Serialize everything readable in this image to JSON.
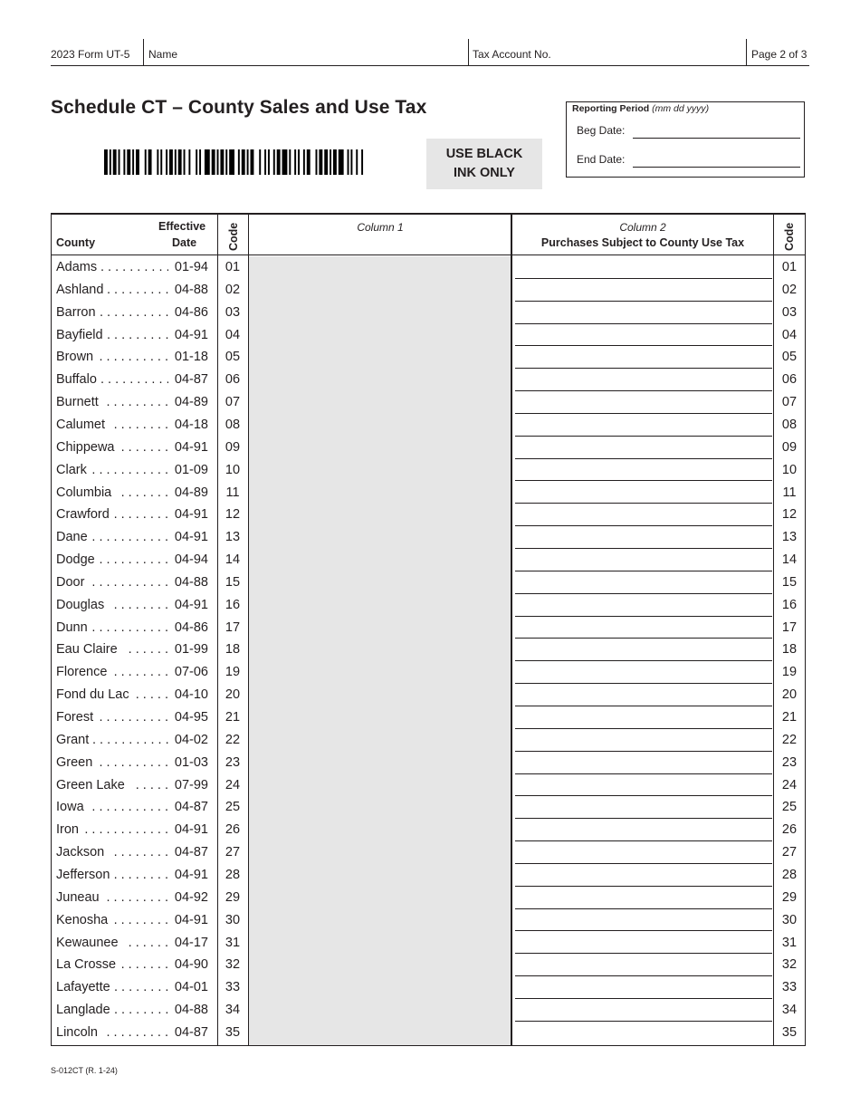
{
  "header": {
    "form": "2023 Form UT-5",
    "name_label": "Name",
    "tax_account_label": "Tax Account No.",
    "page": "Page 2 of 3"
  },
  "title": "Schedule CT – County Sales and Use Tax",
  "ink_notice": {
    "line1": "USE BLACK",
    "line2": "INK ONLY"
  },
  "reporting_period": {
    "title": "Reporting Period",
    "format_hint": "(mm dd yyyy)",
    "beg_label": "Beg Date:",
    "beg_value": "",
    "end_label": "End Date:",
    "end_value": ""
  },
  "table": {
    "headers": {
      "county": "County",
      "effective": "Effective",
      "date": "Date",
      "code": "Code",
      "column1": "Column 1",
      "column2": "Column 2",
      "column2_title": "Purchases Subject to County Use Tax",
      "code_right": "Code"
    },
    "rows": [
      {
        "county": "Adams",
        "date": "01-94",
        "code": "01"
      },
      {
        "county": "Ashland",
        "date": "04-88",
        "code": "02"
      },
      {
        "county": "Barron",
        "date": "04-86",
        "code": "03"
      },
      {
        "county": "Bayfield",
        "date": "04-91",
        "code": "04"
      },
      {
        "county": "Brown",
        "date": "01-18",
        "code": "05"
      },
      {
        "county": "Buffalo",
        "date": "04-87",
        "code": "06"
      },
      {
        "county": "Burnett",
        "date": "04-89",
        "code": "07"
      },
      {
        "county": "Calumet",
        "date": "04-18",
        "code": "08"
      },
      {
        "county": "Chippewa",
        "date": "04-91",
        "code": "09"
      },
      {
        "county": "Clark",
        "date": "01-09",
        "code": "10"
      },
      {
        "county": "Columbia",
        "date": "04-89",
        "code": "11"
      },
      {
        "county": "Crawford",
        "date": "04-91",
        "code": "12"
      },
      {
        "county": "Dane",
        "date": "04-91",
        "code": "13"
      },
      {
        "county": "Dodge",
        "date": "04-94",
        "code": "14"
      },
      {
        "county": "Door",
        "date": "04-88",
        "code": "15"
      },
      {
        "county": "Douglas",
        "date": "04-91",
        "code": "16"
      },
      {
        "county": "Dunn",
        "date": "04-86",
        "code": "17"
      },
      {
        "county": "Eau Claire",
        "date": "01-99",
        "code": "18"
      },
      {
        "county": "Florence",
        "date": "07-06",
        "code": "19"
      },
      {
        "county": "Fond du Lac",
        "date": "04-10",
        "code": "20"
      },
      {
        "county": "Forest",
        "date": "04-95",
        "code": "21"
      },
      {
        "county": "Grant",
        "date": "04-02",
        "code": "22"
      },
      {
        "county": "Green",
        "date": "01-03",
        "code": "23"
      },
      {
        "county": "Green Lake",
        "date": "07-99",
        "code": "24"
      },
      {
        "county": "Iowa",
        "date": "04-87",
        "code": "25"
      },
      {
        "county": "Iron",
        "date": "04-91",
        "code": "26"
      },
      {
        "county": "Jackson",
        "date": "04-87",
        "code": "27"
      },
      {
        "county": "Jefferson",
        "date": "04-91",
        "code": "28"
      },
      {
        "county": "Juneau",
        "date": "04-92",
        "code": "29"
      },
      {
        "county": "Kenosha",
        "date": "04-91",
        "code": "30"
      },
      {
        "county": "Kewaunee",
        "date": "04-17",
        "code": "31"
      },
      {
        "county": "La Crosse",
        "date": "04-90",
        "code": "32"
      },
      {
        "county": "Lafayette",
        "date": "04-01",
        "code": "33"
      },
      {
        "county": "Langlade",
        "date": "04-88",
        "code": "34"
      },
      {
        "county": "Lincoln",
        "date": "04-87",
        "code": "35"
      }
    ]
  },
  "footer": "S-012CT (R. 1-24)",
  "colors": {
    "ink": "#231f20",
    "shade": "#e6e6e6"
  }
}
